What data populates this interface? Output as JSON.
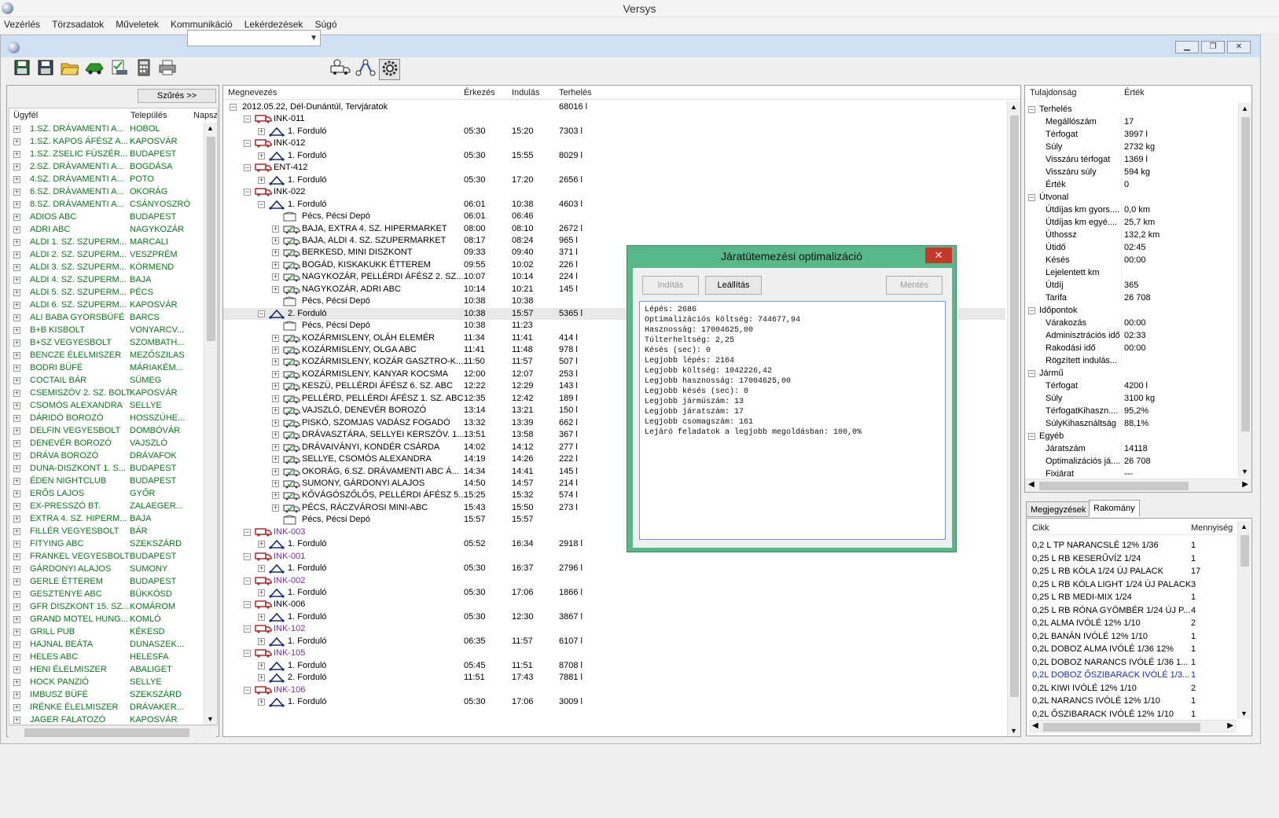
{
  "app": {
    "title": "Versys"
  },
  "menu": [
    "Vezérlés",
    "Törzsadatok",
    "Műveletek",
    "Kommunikáció",
    "Lekérdezések",
    "Súgó"
  ],
  "mdi_buttons": [
    "▁",
    "❐",
    "✕"
  ],
  "toolbar": {
    "icons": [
      "save-icon",
      "save-as-icon",
      "open-folder-icon",
      "truck-green-icon",
      "check-list-icon",
      "calculator-icon",
      "print-icon",
      "route-add-icon",
      "route-edit-icon",
      "settings-gear-icon"
    ],
    "combo_value": ""
  },
  "left": {
    "filter_label": "Szűrés >>",
    "columns": [
      "Ügyfél",
      "Település",
      "Napsza"
    ],
    "rows": [
      [
        "1.SZ. DRÁVAMENTI A...",
        "HOBOL"
      ],
      [
        "1.SZ. KAPOS ÁFÉSZ A...",
        "KAPOSVÁR"
      ],
      [
        "1.SZ. ZSELIC FÜSZÉR...",
        "BUDAPEST"
      ],
      [
        "2.SZ. DRÁVAMENTI A...",
        "BOGDÁSA"
      ],
      [
        "4.SZ. DRÁVAMENTI A...",
        "POTO"
      ],
      [
        "6.SZ. DRÁVAMENTI A...",
        "OKORÁG"
      ],
      [
        "8.SZ. DRÁVAMENTI A...",
        "CSÁNYOSZRÓ"
      ],
      [
        "ADIOS ABC",
        "BUDAPEST"
      ],
      [
        "ADRI ABC",
        "NAGYKOZÁR"
      ],
      [
        "ALDI 1. SZ. SZUPERM...",
        "MARCALI"
      ],
      [
        "ALDI 2. SZ. SZUPERM...",
        "VESZPRÉM"
      ],
      [
        "ALDI 3. SZ. SZUPERM...",
        "KÖRMEND"
      ],
      [
        "ALDI 4. SZ. SZUPERM...",
        "BAJA"
      ],
      [
        "ALDI 5. SZ. SZUPERM...",
        "PÉCS"
      ],
      [
        "ALDI 6. SZ. SZUPERM...",
        "KAPOSVÁR"
      ],
      [
        "ALI BABA GYORSBÜFÉ",
        "BARCS"
      ],
      [
        "B+B KISBOLT",
        "VONYARCV..."
      ],
      [
        "B+SZ VEGYESBOLT",
        "SZOMBATH..."
      ],
      [
        "BENCZE ÉLELMISZER",
        "MEZŐSZILAS"
      ],
      [
        "BODRI BÜFÉ",
        "MÁRIAKÉM..."
      ],
      [
        "COCTAIL BÁR",
        "SÜMEG"
      ],
      [
        "CSEMISZÖV 2. SZ. BOLT",
        "KAPOSVÁR"
      ],
      [
        "CSOMÓS ALEXANDRA",
        "SELLYE"
      ],
      [
        "DÁRIDÓ BOROZÓ",
        "HOSSZÚHE..."
      ],
      [
        "DELFIN VEGYESBOLT",
        "DOMBÓVÁR"
      ],
      [
        "DENEVÉR BOROZÓ",
        "VAJSZLÓ"
      ],
      [
        "DRÁVA BOROZÓ",
        "DRÁVAFOK"
      ],
      [
        "DUNA-DISZKONT 1. S...",
        "BUDAPEST"
      ],
      [
        "ÉDEN NIGHTCLUB",
        "BUDAPEST"
      ],
      [
        "ERŐS LAJOS",
        "GYŐR"
      ],
      [
        "EX-PRESSZÓ BT.",
        "ZALAEGER..."
      ],
      [
        "EXTRA 4. SZ. HIPERM...",
        "BAJA"
      ],
      [
        "FILLÉR VEGYESBOLT",
        "BÁR"
      ],
      [
        "FITYING ABC",
        "SZEKSZÁRD"
      ],
      [
        "FRANKEL VEGYESBOLT",
        "BUDAPEST"
      ],
      [
        "GÁRDONYI ALAJOS",
        "SUMONY"
      ],
      [
        "GERLE ÉTTEREM",
        "BUDAPEST"
      ],
      [
        "GESZTENYE ABC",
        "BÜKKÖSD"
      ],
      [
        "GFR DISZKONT 15. SZ...",
        "KOMÁROM"
      ],
      [
        "GRAND MOTEL HUNG...",
        "KOMLÓ"
      ],
      [
        "GRILL PUB",
        "KÉKESD"
      ],
      [
        "HAJNAL BEÁTA",
        "DUNASZEK..."
      ],
      [
        "HELES ABC",
        "HELESFA"
      ],
      [
        "HENI ÉLELMISZER",
        "ABALIGET"
      ],
      [
        "HOCK PANZIÓ",
        "SELLYE"
      ],
      [
        "IMBUSZ BÜFÉ",
        "SZEKSZÁRD"
      ],
      [
        "IRÉNKE ÉLELMISZER",
        "DRÁVAKER..."
      ],
      [
        "JAGER FALATOZÓ",
        "KAPOSVÁR"
      ]
    ]
  },
  "center": {
    "columns": [
      "Megnevezés",
      "Érkezés",
      "Indulás",
      "Terhelés"
    ],
    "rows": [
      {
        "lvl": 0,
        "icon": "none",
        "exp": "−",
        "name": "2012.05.22, Dél-Dunántúl, Tervjáratok",
        "arr": "",
        "dep": "",
        "load": "68016 l",
        "color": ""
      },
      {
        "lvl": 1,
        "icon": "truck-icon",
        "exp": "−",
        "name": "INK-011",
        "arr": "",
        "dep": "",
        "load": "",
        "color": ""
      },
      {
        "lvl": 2,
        "icon": "route-icon",
        "exp": "+",
        "name": "1. Forduló",
        "arr": "05:30",
        "dep": "15:20",
        "load": "7303 l",
        "color": ""
      },
      {
        "lvl": 1,
        "icon": "truck-icon",
        "exp": "−",
        "name": "INK-012",
        "arr": "",
        "dep": "",
        "load": "",
        "color": ""
      },
      {
        "lvl": 2,
        "icon": "route-icon",
        "exp": "+",
        "name": "1. Forduló",
        "arr": "05:30",
        "dep": "15:55",
        "load": "8029 l",
        "color": ""
      },
      {
        "lvl": 1,
        "icon": "truck-icon",
        "exp": "−",
        "name": "ENT-412",
        "arr": "",
        "dep": "",
        "load": "",
        "color": ""
      },
      {
        "lvl": 2,
        "icon": "route-icon",
        "exp": "+",
        "name": "1. Forduló",
        "arr": "05:30",
        "dep": "17:20",
        "load": "2656 l",
        "color": ""
      },
      {
        "lvl": 1,
        "icon": "truck-icon",
        "exp": "−",
        "name": "INK-022",
        "arr": "",
        "dep": "",
        "load": "",
        "color": ""
      },
      {
        "lvl": 2,
        "icon": "route-icon",
        "exp": "−",
        "name": "1. Forduló",
        "arr": "06:01",
        "dep": "10:38",
        "load": "4603 l",
        "color": ""
      },
      {
        "lvl": 3,
        "icon": "depot-icon",
        "exp": "",
        "name": "Pécs, Pécsi Depó",
        "arr": "06:01",
        "dep": "06:46",
        "load": "",
        "color": ""
      },
      {
        "lvl": 3,
        "icon": "stop-icon",
        "exp": "+",
        "name": "BAJA, EXTRA 4. SZ. HIPERMARKET",
        "arr": "08:00",
        "dep": "08:10",
        "load": "2672 l",
        "color": ""
      },
      {
        "lvl": 3,
        "icon": "stop-icon",
        "exp": "+",
        "name": "BAJA, ALDI 4. SZ. SZUPERMARKET",
        "arr": "08:17",
        "dep": "08:24",
        "load": "965 l",
        "color": ""
      },
      {
        "lvl": 3,
        "icon": "stop-icon",
        "exp": "+",
        "name": "BERKESD, MINI DISZKONT",
        "arr": "09:33",
        "dep": "09:40",
        "load": "371 l",
        "color": ""
      },
      {
        "lvl": 3,
        "icon": "stop-icon",
        "exp": "+",
        "name": "BOGÁD, KISKAKUKK ÉTTEREM",
        "arr": "09:55",
        "dep": "10:02",
        "load": "226 l",
        "color": ""
      },
      {
        "lvl": 3,
        "icon": "stop-icon",
        "exp": "+",
        "name": "NAGYKOZÁR, PELLÉRDI ÁFÉSZ 2. SZ....",
        "arr": "10:07",
        "dep": "10:14",
        "load": "224 l",
        "color": ""
      },
      {
        "lvl": 3,
        "icon": "stop-icon",
        "exp": "+",
        "name": "NAGYKOZÁR, ADRI ABC",
        "arr": "10:14",
        "dep": "10:21",
        "load": "145 l",
        "color": ""
      },
      {
        "lvl": 3,
        "icon": "depot-icon",
        "exp": "",
        "name": "Pécs, Pécsi Depó",
        "arr": "10:38",
        "dep": "10:38",
        "load": "",
        "color": ""
      },
      {
        "lvl": 2,
        "icon": "route-icon",
        "exp": "−",
        "name": "2. Forduló",
        "arr": "10:38",
        "dep": "15:57",
        "load": "5365 l",
        "color": "",
        "sel": true
      },
      {
        "lvl": 3,
        "icon": "depot-icon",
        "exp": "",
        "name": "Pécs, Pécsi Depó",
        "arr": "10:38",
        "dep": "11:23",
        "load": "",
        "color": ""
      },
      {
        "lvl": 3,
        "icon": "stop-icon",
        "exp": "+",
        "name": "KOZÁRMISLENY, OLÁH ELEMÉR",
        "arr": "11:34",
        "dep": "11:41",
        "load": "414 l",
        "color": ""
      },
      {
        "lvl": 3,
        "icon": "stop-icon",
        "exp": "+",
        "name": "KOZÁRMISLENY, OLGA ABC",
        "arr": "11:41",
        "dep": "11:48",
        "load": "978 l",
        "color": ""
      },
      {
        "lvl": 3,
        "icon": "stop-icon",
        "exp": "+",
        "name": "KOZÁRMISLENY, KOZÁR GASZTRO-K....",
        "arr": "11:50",
        "dep": "11:57",
        "load": "507 l",
        "color": ""
      },
      {
        "lvl": 3,
        "icon": "stop-icon",
        "exp": "+",
        "name": "KOZÁRMISLENY, KANYAR KOCSMA",
        "arr": "12:00",
        "dep": "12:07",
        "load": "253 l",
        "color": ""
      },
      {
        "lvl": 3,
        "icon": "stop-icon",
        "exp": "+",
        "name": "KESZÜ, PELLÉRDI ÁFÉSZ 6. SZ. ABC",
        "arr": "12:22",
        "dep": "12:29",
        "load": "143 l",
        "color": ""
      },
      {
        "lvl": 3,
        "icon": "stop-icon",
        "exp": "+",
        "name": "PELLÉRD, PELLÉRDI ÁFÉSZ 1. SZ. ABC",
        "arr": "12:35",
        "dep": "12:42",
        "load": "189 l",
        "color": ""
      },
      {
        "lvl": 3,
        "icon": "stop-icon",
        "exp": "+",
        "name": "VAJSZLÓ, DENEVÉR BOROZÓ",
        "arr": "13:14",
        "dep": "13:21",
        "load": "150 l",
        "color": ""
      },
      {
        "lvl": 3,
        "icon": "stop-icon",
        "exp": "+",
        "name": "PISKÓ, SZOMJAS VADÁSZ FOGADÓ",
        "arr": "13:32",
        "dep": "13:39",
        "load": "662 l",
        "color": ""
      },
      {
        "lvl": 3,
        "icon": "stop-icon",
        "exp": "+",
        "name": "DRÁVASZTÁRA, SELLYEI KERSZÖV. 1....",
        "arr": "13:51",
        "dep": "13:58",
        "load": "367 l",
        "color": ""
      },
      {
        "lvl": 3,
        "icon": "stop-icon",
        "exp": "+",
        "name": "DRÁVAIVÁNYI, KONDÉR CSÁRDA",
        "arr": "14:02",
        "dep": "14:12",
        "load": "277 l",
        "color": ""
      },
      {
        "lvl": 3,
        "icon": "stop-icon",
        "exp": "+",
        "name": "SELLYE, CSOMÓS ALEXANDRA",
        "arr": "14:19",
        "dep": "14:26",
        "load": "222 l",
        "color": ""
      },
      {
        "lvl": 3,
        "icon": "stop-icon",
        "exp": "+",
        "name": "OKORÁG, 6.SZ. DRÁVAMENTI ABC Á...",
        "arr": "14:34",
        "dep": "14:41",
        "load": "145 l",
        "color": ""
      },
      {
        "lvl": 3,
        "icon": "stop-icon",
        "exp": "+",
        "name": "SUMONY, GÁRDONYI ALAJOS",
        "arr": "14:50",
        "dep": "14:57",
        "load": "214 l",
        "color": ""
      },
      {
        "lvl": 3,
        "icon": "stop-icon",
        "exp": "+",
        "name": "KŐVÁGÓSZŐLŐS, PELLÉRDI ÁFÉSZ 5....",
        "arr": "15:25",
        "dep": "15:32",
        "load": "574 l",
        "color": ""
      },
      {
        "lvl": 3,
        "icon": "stop-icon",
        "exp": "+",
        "name": "PÉCS, RÁCZVÁROSI MINI-ABC",
        "arr": "15:43",
        "dep": "15:50",
        "load": "273 l",
        "color": ""
      },
      {
        "lvl": 3,
        "icon": "depot-icon",
        "exp": "",
        "name": "Pécs, Pécsi Depó",
        "arr": "15:57",
        "dep": "15:57",
        "load": "",
        "color": ""
      },
      {
        "lvl": 1,
        "icon": "truck-icon",
        "exp": "−",
        "name": "INK-003",
        "arr": "",
        "dep": "",
        "load": "",
        "color": "purple"
      },
      {
        "lvl": 2,
        "icon": "route-icon",
        "exp": "+",
        "name": "1. Forduló",
        "arr": "05:52",
        "dep": "16:34",
        "load": "2918 l",
        "color": ""
      },
      {
        "lvl": 1,
        "icon": "truck-icon",
        "exp": "−",
        "name": "INK-001",
        "arr": "",
        "dep": "",
        "load": "",
        "color": "purple"
      },
      {
        "lvl": 2,
        "icon": "route-icon",
        "exp": "+",
        "name": "1. Forduló",
        "arr": "05:30",
        "dep": "16:37",
        "load": "2796 l",
        "color": ""
      },
      {
        "lvl": 1,
        "icon": "truck-icon",
        "exp": "−",
        "name": "INK-002",
        "arr": "",
        "dep": "",
        "load": "",
        "color": "purple"
      },
      {
        "lvl": 2,
        "icon": "route-icon",
        "exp": "+",
        "name": "1. Forduló",
        "arr": "05:30",
        "dep": "17:06",
        "load": "1866 l",
        "color": ""
      },
      {
        "lvl": 1,
        "icon": "truck-icon",
        "exp": "−",
        "name": "INK-006",
        "arr": "",
        "dep": "",
        "load": "",
        "color": ""
      },
      {
        "lvl": 2,
        "icon": "route-icon",
        "exp": "+",
        "name": "1. Forduló",
        "arr": "05:30",
        "dep": "12:30",
        "load": "3867 l",
        "color": ""
      },
      {
        "lvl": 1,
        "icon": "truck-icon",
        "exp": "−",
        "name": "INK-102",
        "arr": "",
        "dep": "",
        "load": "",
        "color": "purple"
      },
      {
        "lvl": 2,
        "icon": "route-icon",
        "exp": "+",
        "name": "1. Forduló",
        "arr": "06:35",
        "dep": "11:57",
        "load": "6107 l",
        "color": ""
      },
      {
        "lvl": 1,
        "icon": "truck-icon",
        "exp": "−",
        "name": "INK-105",
        "arr": "",
        "dep": "",
        "load": "",
        "color": "purple"
      },
      {
        "lvl": 2,
        "icon": "route-icon",
        "exp": "+",
        "name": "1. Forduló",
        "arr": "05:45",
        "dep": "11:51",
        "load": "8708 l",
        "color": ""
      },
      {
        "lvl": 2,
        "icon": "route-icon",
        "exp": "+",
        "name": "2. Forduló",
        "arr": "11:51",
        "dep": "17:43",
        "load": "7881 l",
        "color": ""
      },
      {
        "lvl": 1,
        "icon": "truck-icon",
        "exp": "−",
        "name": "INK-106",
        "arr": "",
        "dep": "",
        "load": "",
        "color": "purple"
      },
      {
        "lvl": 2,
        "icon": "route-icon",
        "exp": "+",
        "name": "1. Forduló",
        "arr": "05:30",
        "dep": "17:06",
        "load": "3009 l",
        "color": ""
      }
    ]
  },
  "dialog": {
    "title": "Járatütemezési optimalizáció",
    "buttons": {
      "start": "Indítás",
      "stop": "Leállítás",
      "save": "Mentés"
    },
    "log": "Lépés: 2686\nOptimalizációs költség: 744677,94\nHasznosság: 17004625,00\nTúlterheltség: 2,25\nKésés (sec): 0\nLegjobb lépés: 2164\nLegjobb költség: 1042226,42\nLegjobb hasznosság: 17004625,00\nLegjobb késés (sec): 0\nLegjobb járműszám: 13\nLegjobb járatszám: 17\nLegjobb csomagszám: 161\nLejáró feladatok a legjobb megoldásban: 100,0%"
  },
  "props": {
    "columns": [
      "Tulajdonság",
      "Érték"
    ],
    "rows": [
      {
        "g": true,
        "exp": "−",
        "k": "Terhelés",
        "v": ""
      },
      {
        "k": "Megállószám",
        "v": "17"
      },
      {
        "k": "Térfogat",
        "v": "3997 l"
      },
      {
        "k": "Súly",
        "v": "2732 kg"
      },
      {
        "k": "Visszáru térfogat",
        "v": "1369 l"
      },
      {
        "k": "Visszáru súly",
        "v": "594 kg"
      },
      {
        "k": "Érték",
        "v": "0"
      },
      {
        "g": true,
        "exp": "−",
        "k": "Útvonal",
        "v": ""
      },
      {
        "k": "Útdíjas km gyors....",
        "v": "0,0 km"
      },
      {
        "k": "Útdíjas km egyé....",
        "v": "25,7 km"
      },
      {
        "k": "Úthossz",
        "v": "132,2 km"
      },
      {
        "k": "Útidő",
        "v": "02:45"
      },
      {
        "k": "Késés",
        "v": "00:00"
      },
      {
        "k": "Lejelentett km",
        "v": ""
      },
      {
        "k": "Útdíj",
        "v": "365"
      },
      {
        "k": "Tarifa",
        "v": "26 708"
      },
      {
        "g": true,
        "exp": "−",
        "k": "Időpontok",
        "v": ""
      },
      {
        "k": "Várakozás",
        "v": "00:00"
      },
      {
        "k": "Adminisztrációs idő",
        "v": "02:33"
      },
      {
        "k": "Rakodási idő",
        "v": "00:00"
      },
      {
        "k": "Rögzített indulás...",
        "v": ""
      },
      {
        "g": true,
        "exp": "−",
        "k": "Jármű",
        "v": ""
      },
      {
        "k": "Térfogat",
        "v": "4200 l"
      },
      {
        "k": "Súly",
        "v": "3100 kg"
      },
      {
        "k": "TérfogatKihaszn....",
        "v": "95,2%"
      },
      {
        "k": "SúlyKihasználtság",
        "v": "88,1%"
      },
      {
        "g": true,
        "exp": "−",
        "k": "Egyéb",
        "v": ""
      },
      {
        "k": "Járatszám",
        "v": "14118"
      },
      {
        "k": "Optimalizációs já....",
        "v": "26 708"
      },
      {
        "k": "Fixjárat",
        "v": "---"
      }
    ]
  },
  "tabs": [
    "Megjegyzések",
    "Rakomány"
  ],
  "cargo": {
    "columns": [
      "Cikk",
      "Mennyiség"
    ],
    "rows": [
      [
        "0,2 L TP NARANCSLÉ 12% 1/36",
        "1",
        ""
      ],
      [
        "0,25 L RB KESERŰVÍZ 1/24",
        "1",
        ""
      ],
      [
        "0,25 L RB KÓLA 1/24 ÚJ PALACK",
        "17",
        ""
      ],
      [
        "0,25 L RB KÓLA LIGHT 1/24 ÚJ PALACK",
        "3",
        ""
      ],
      [
        "0,25 L RB MEDI-MIX 1/24",
        "1",
        ""
      ],
      [
        "0,25 L RB RÓNA GYÖMBÉR 1/24 ÚJ P...",
        "4",
        ""
      ],
      [
        "0,2L ALMA IVÓLÉ 12% 1/10",
        "2",
        ""
      ],
      [
        "0,2L BANÁN IVÓLÉ 12% 1/10",
        "1",
        ""
      ],
      [
        "0,2L DOBOZ ALMA IVÓLÉ 1/36 12%",
        "1",
        ""
      ],
      [
        "0,2L DOBOZ NARANCS IVÓLÉ 1/36 1...",
        "1",
        ""
      ],
      [
        "0,2L DOBOZ ŐSZIBARACK IVÓLÉ 1/3...",
        "1",
        "blue"
      ],
      [
        "0,2L KIWI IVÓLÉ 12% 1/10",
        "2",
        ""
      ],
      [
        "0,2L NARANCS IVÓLÉ 12% 1/10",
        "1",
        ""
      ],
      [
        "0,2L ŐSZIBARACK IVÓLÉ 12% 1/10",
        "1",
        ""
      ]
    ]
  }
}
